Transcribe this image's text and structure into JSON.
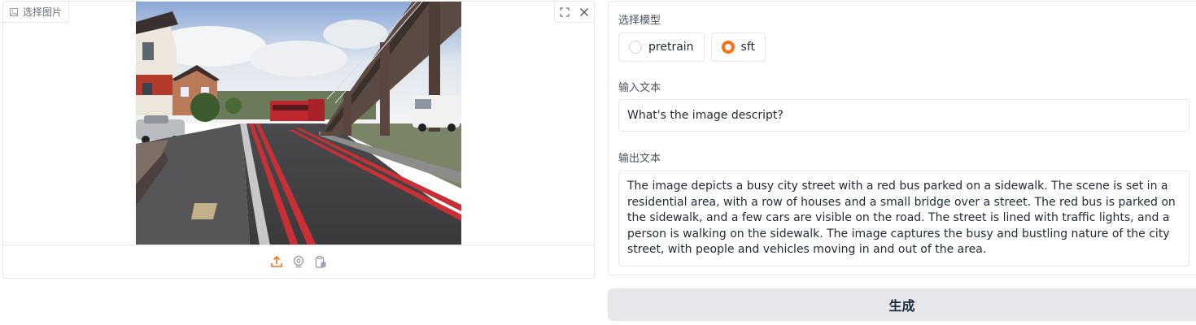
{
  "image_panel": {
    "label": "选择图片",
    "icons": {
      "label": "image-icon",
      "fullscreen": "fullscreen-icon",
      "clear": "close-icon",
      "upload": "upload-icon",
      "webcam": "webcam-icon",
      "clipboard": "clipboard-icon"
    },
    "accent_color": "#f97316"
  },
  "model_select": {
    "label": "选择模型",
    "options": [
      {
        "label": "pretrain",
        "checked": false
      },
      {
        "label": "sft",
        "checked": true
      }
    ]
  },
  "input": {
    "label": "输入文本",
    "value": "What's the image descript?"
  },
  "output": {
    "label": "输出文本",
    "value": "The image depicts a busy city street with a red bus parked on a sidewalk. The scene is set in a residential area, with a row of houses and a small bridge over a street. The red bus is parked on the sidewalk, and a few cars are visible on the road. The street is lined with traffic lights, and a person is walking on the sidewalk. The image captures the busy and bustling nature of the city street, with people and vehicles moving in and out of the area."
  },
  "generate_button": {
    "label": "生成"
  }
}
